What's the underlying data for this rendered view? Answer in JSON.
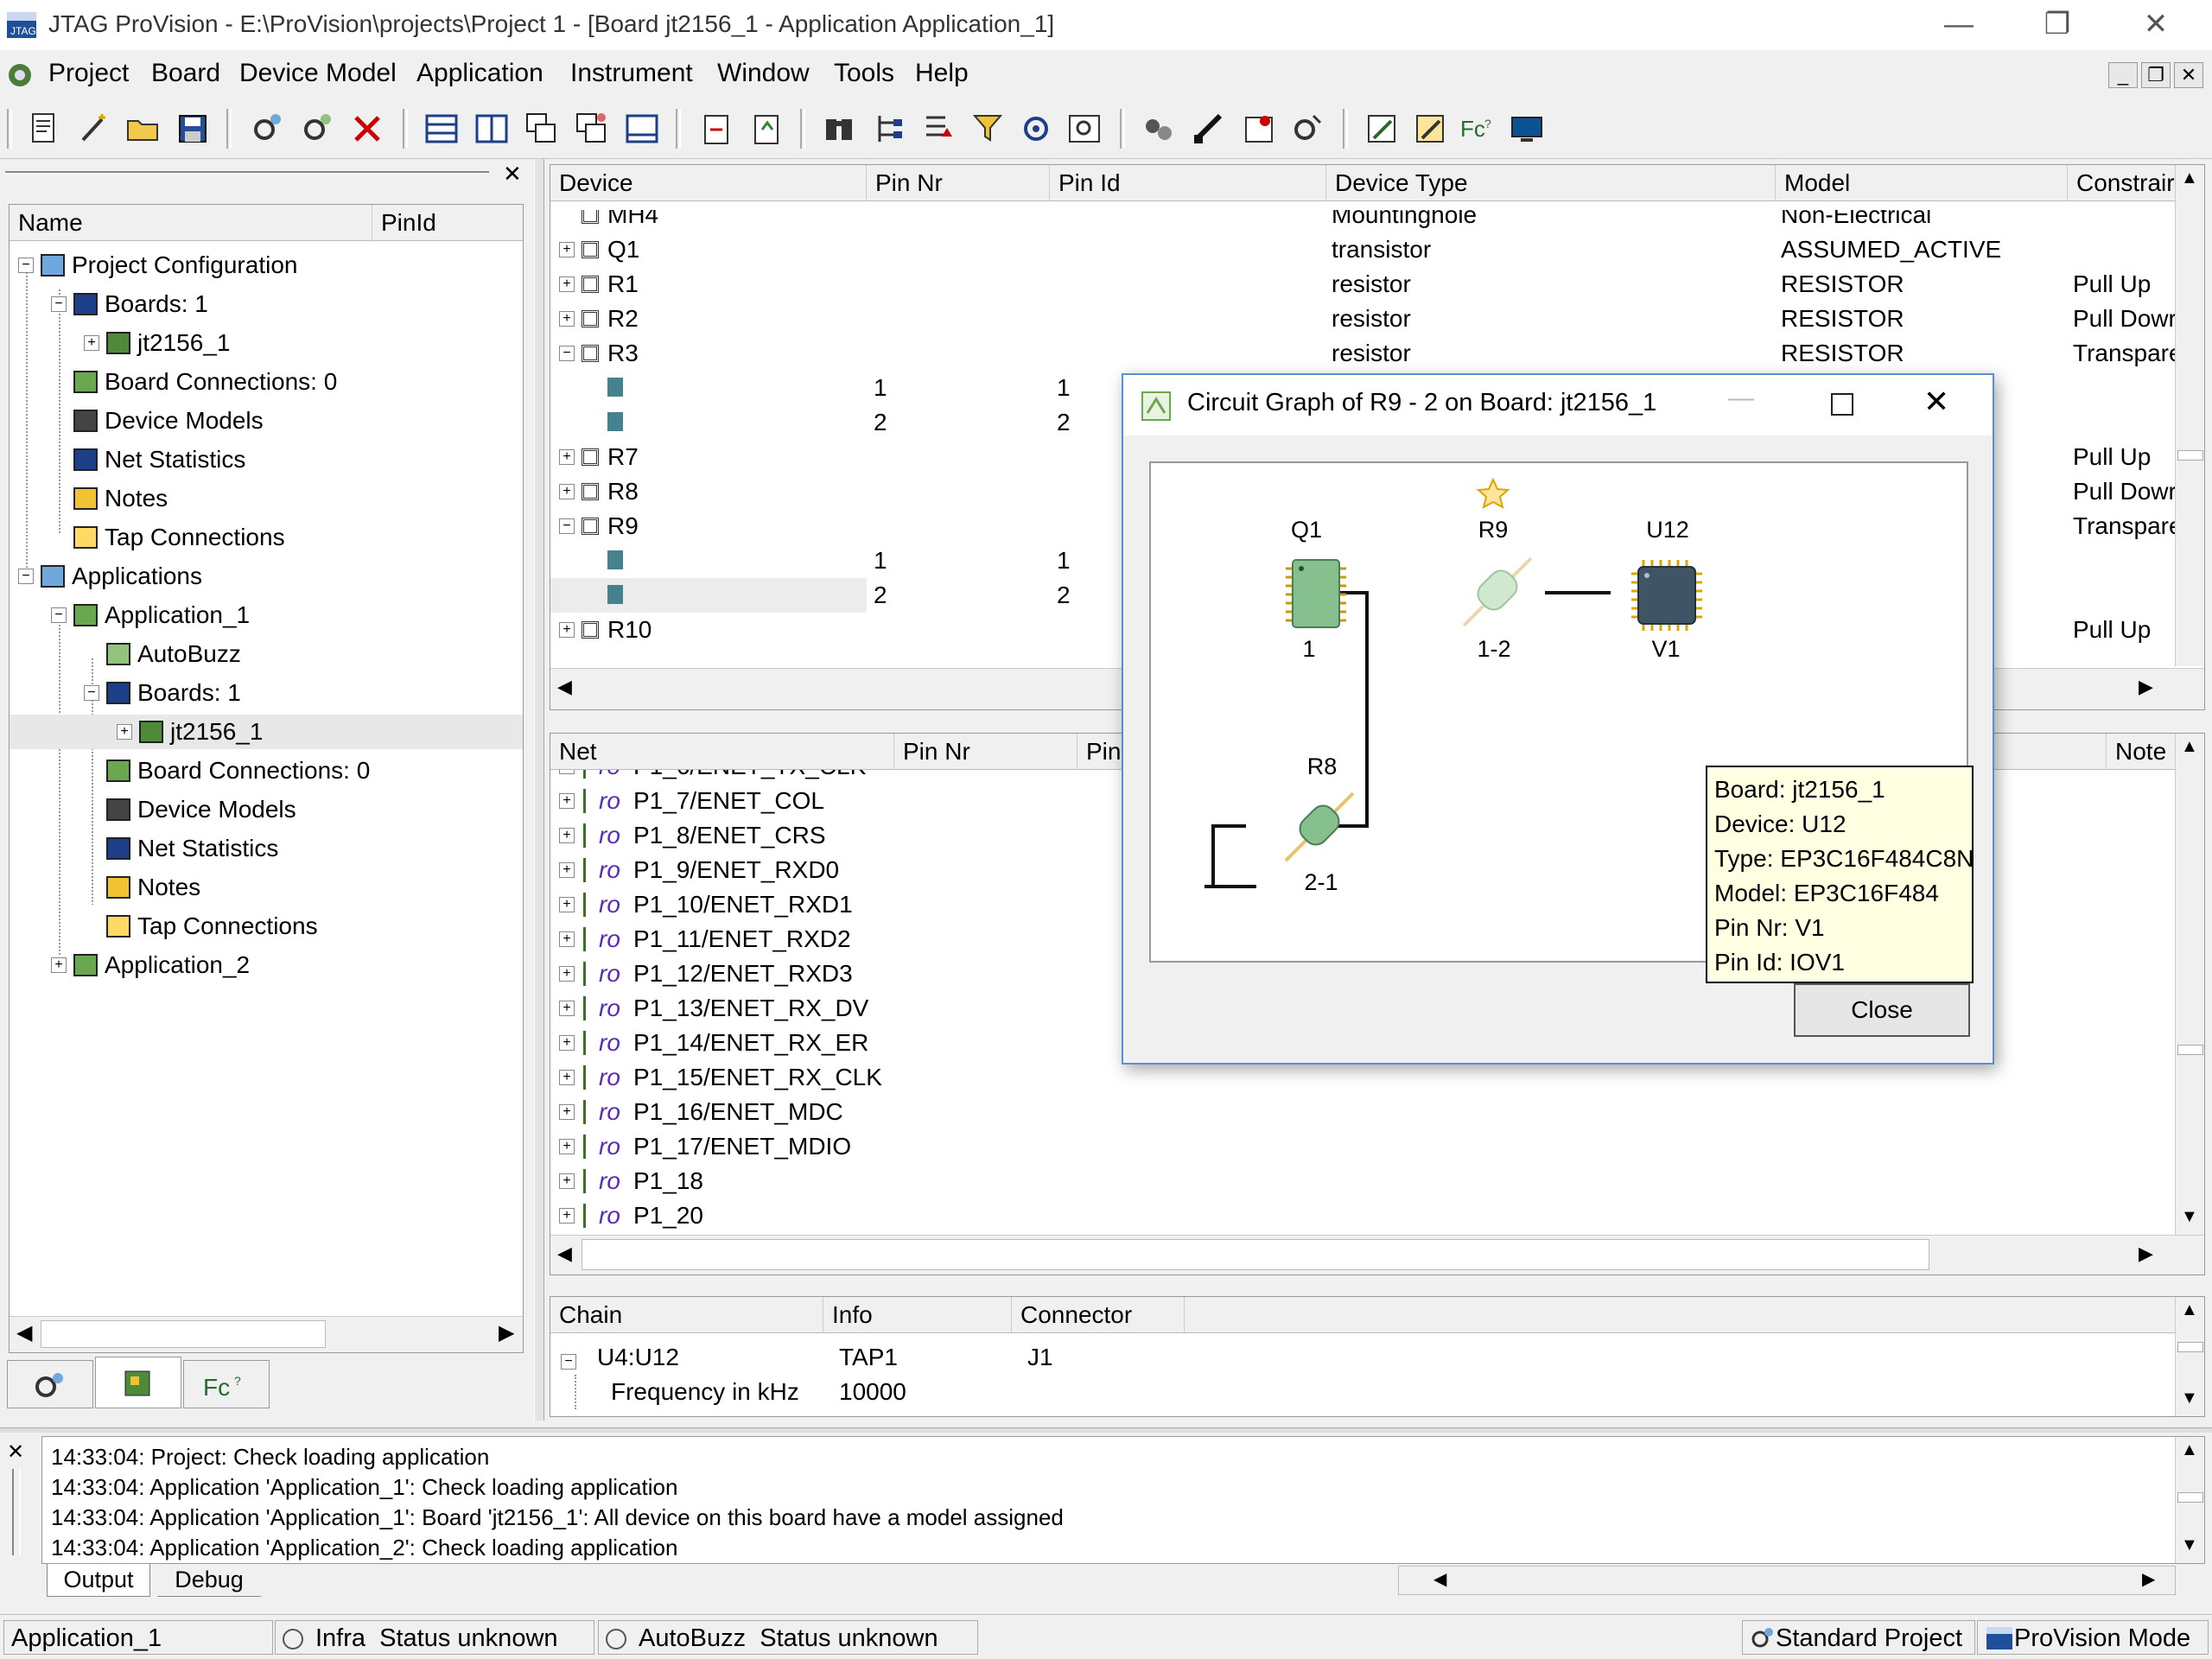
{
  "window": {
    "title": "JTAG ProVision - E:\\ProVision\\projects\\Project 1 - [Board jt2156_1 - Application Application_1]",
    "minimize": "—",
    "restore": "❐",
    "close": "✕"
  },
  "menubar": {
    "items": [
      "Project",
      "Board",
      "Device Model",
      "Application",
      "Instrument",
      "Window",
      "Tools",
      "Help"
    ]
  },
  "project_tree": {
    "columns": [
      "Name",
      "PinId"
    ],
    "nodes": [
      {
        "label": "Project Configuration",
        "icon": "gears-icon"
      },
      {
        "label": "Boards: 1",
        "icon": "boards-icon"
      },
      {
        "label": "jt2156_1",
        "icon": "board-icon"
      },
      {
        "label": "Board Connections: 0",
        "icon": "connections-icon"
      },
      {
        "label": "Device Models",
        "icon": "device-models-icon"
      },
      {
        "label": "Net Statistics",
        "icon": "net-statistics-icon"
      },
      {
        "label": "Notes",
        "icon": "notes-icon"
      },
      {
        "label": "Tap Connections",
        "icon": "tap-icon"
      },
      {
        "label": "Applications",
        "icon": "applications-icon"
      },
      {
        "label": "Application_1",
        "icon": "application-icon"
      },
      {
        "label": "AutoBuzz",
        "icon": "autobuzz-icon"
      },
      {
        "label": "Boards: 1",
        "icon": "boards-icon"
      },
      {
        "label": "jt2156_1",
        "icon": "board-icon"
      },
      {
        "label": "Board Connections: 0",
        "icon": "connections-icon"
      },
      {
        "label": "Device Models",
        "icon": "device-models-icon"
      },
      {
        "label": "Net Statistics",
        "icon": "net-statistics-icon"
      },
      {
        "label": "Notes",
        "icon": "notes-icon"
      },
      {
        "label": "Tap Connections",
        "icon": "tap-icon"
      },
      {
        "label": "Application_2",
        "icon": "application-icon"
      }
    ]
  },
  "device_table": {
    "columns": [
      "Device",
      "Pin Nr",
      "Pin Id",
      "Device Type",
      "Model",
      "Constrair"
    ],
    "rows": [
      {
        "device": "MH4",
        "pin_nr": "",
        "pin_id": "",
        "type": "Mountinghole",
        "model": "Non-Electrical",
        "constraint": ""
      },
      {
        "device": "Q1",
        "pin_nr": "",
        "pin_id": "",
        "type": "transistor",
        "model": "ASSUMED_ACTIVE",
        "constraint": ""
      },
      {
        "device": "R1",
        "pin_nr": "",
        "pin_id": "",
        "type": "resistor",
        "model": "RESISTOR",
        "constraint": "Pull Up"
      },
      {
        "device": "R2",
        "pin_nr": "",
        "pin_id": "",
        "type": "resistor",
        "model": "RESISTOR",
        "constraint": "Pull Dowr"
      },
      {
        "device": "R3",
        "pin_nr": "",
        "pin_id": "",
        "type": "resistor",
        "model": "RESISTOR",
        "constraint": "Transpare"
      },
      {
        "device": "",
        "pin_nr": "1",
        "pin_id": "1",
        "type": "",
        "model": "",
        "constraint": ""
      },
      {
        "device": "",
        "pin_nr": "2",
        "pin_id": "2",
        "type": "",
        "model": "",
        "constraint": ""
      },
      {
        "device": "R7",
        "pin_nr": "",
        "pin_id": "",
        "type": "",
        "model": "",
        "constraint": "Pull Up"
      },
      {
        "device": "R8",
        "pin_nr": "",
        "pin_id": "",
        "type": "",
        "model": "",
        "constraint": "Pull Dowr"
      },
      {
        "device": "R9",
        "pin_nr": "",
        "pin_id": "",
        "type": "",
        "model": "",
        "constraint": "Transpare"
      },
      {
        "device": "",
        "pin_nr": "1",
        "pin_id": "1",
        "type": "",
        "model": "",
        "constraint": ""
      },
      {
        "device": "",
        "pin_nr": "2",
        "pin_id": "2",
        "type": "",
        "model": "",
        "constraint": ""
      },
      {
        "device": "R10",
        "pin_nr": "",
        "pin_id": "",
        "type": "",
        "model": "",
        "constraint": "Pull Up"
      }
    ]
  },
  "net_table": {
    "columns": [
      "Net",
      "Pin Nr",
      "Pin",
      "Note"
    ],
    "partial_top": "P1_6/ENET_TX_CLK",
    "rows": [
      "P1_7/ENET_COL",
      "P1_8/ENET_CRS",
      "P1_9/ENET_RXD0",
      "P1_10/ENET_RXD1",
      "P1_11/ENET_RXD2",
      "P1_12/ENET_RXD3",
      "P1_13/ENET_RX_DV",
      "P1_14/ENET_RX_ER",
      "P1_15/ENET_RX_CLK",
      "P1_16/ENET_MDC",
      "P1_17/ENET_MDIO",
      "P1_18",
      "P1_20"
    ],
    "io_tag": "ro"
  },
  "chain_table": {
    "columns": [
      "Chain",
      "Info",
      "Connector"
    ],
    "rows": [
      {
        "chain": "U4:U12",
        "info": "TAP1",
        "connector": "J1"
      },
      {
        "chain": "Frequency in kHz",
        "info": "10000",
        "connector": ""
      }
    ]
  },
  "left_tabs": [
    "gears-icon",
    "board-icon",
    "fc-icon"
  ],
  "output": {
    "lines": [
      "14:33:04: Project: Check loading application",
      "14:33:04: Application 'Application_1': Check loading application",
      "14:33:04: Application 'Application_1': Board 'jt2156_1': All device on this board have a model assigned",
      "14:33:04: Application 'Application_2': Check loading application"
    ],
    "tabs": [
      "Output",
      "Debug"
    ]
  },
  "dialog": {
    "title": "Circuit Graph of R9 - 2 on Board: jt2156_1",
    "nodes": {
      "q1": {
        "name": "Q1",
        "pin": "1"
      },
      "r9": {
        "name": "R9",
        "pin": "1-2"
      },
      "u12": {
        "name": "U12",
        "pin": "V1"
      },
      "r8": {
        "name": "R8",
        "pin": "2-1"
      }
    },
    "tooltip": [
      "Board: jt2156_1",
      "Device: U12",
      "Type: EP3C16F484C8N",
      "Model: EP3C16F484",
      "Pin Nr: V1",
      "Pin Id: IOV1"
    ],
    "close_label": "Close"
  },
  "statusbar": {
    "application": "Application_1",
    "infra_label": "Infra",
    "infra_status": "Status unknown",
    "autobuzz_label": "AutoBuzz",
    "autobuzz_status": "Status unknown",
    "standard_project": "Standard Project",
    "mode": "ProVision Mode"
  },
  "colors": {
    "accent": "#5a8fd6",
    "tooltip_bg": "#ffffe1",
    "chip_green": "#7fbf8a",
    "chip_dark": "#3f5566",
    "selection": "#e8e8e8"
  }
}
